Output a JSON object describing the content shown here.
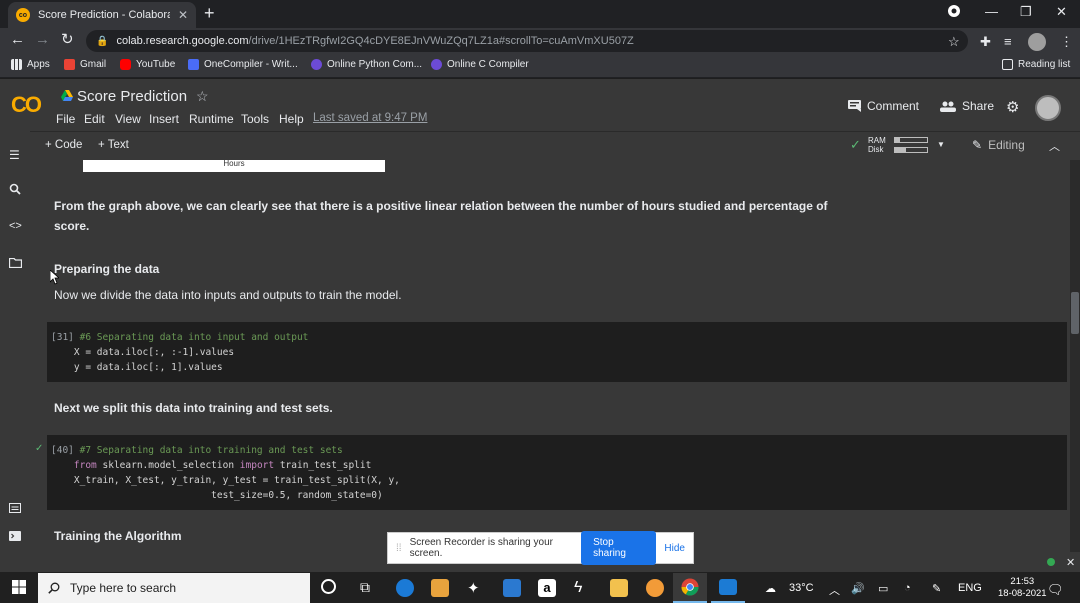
{
  "browser": {
    "tab_title": "Score Prediction - Colaboratory",
    "tab_close": "✕",
    "new_tab": "+",
    "url_host": "colab.research.google.com",
    "url_path": "/drive/1HEzTRgfwI2GQ4cDYE8EJnVWuZQq7LZ1a#scrollTo=cuAmVmXU507Z",
    "bookmarks": [
      "Apps",
      "Gmail",
      "YouTube",
      "OneCompiler - Writ...",
      "Online Python Com...",
      "Online C Compiler"
    ],
    "reading_list": "Reading list"
  },
  "colab": {
    "logo": "CO",
    "title": "Score Prediction",
    "menu": [
      "File",
      "Edit",
      "View",
      "Insert",
      "Runtime",
      "Tools",
      "Help"
    ],
    "last_saved": "Last saved at 9:47 PM",
    "comment": "Comment",
    "share": "Share",
    "add_code": "+ Code",
    "add_text": "+ Text",
    "ram_label": "RAM",
    "disk_label": "Disk",
    "ram_usage": 0.15,
    "disk_usage": 0.35,
    "editing": "Editing"
  },
  "notebook": {
    "plot_xlabel": "Hours",
    "para1": "From the graph above, we can clearly see that there is a positive linear relation between the number of hours studied and percentage of",
    "para1b": "score.",
    "heading1": "Preparing the data",
    "para2": "Now we divide the data into inputs and outputs to train the model.",
    "cell1": {
      "count": "[31]",
      "comment": "#6 Separating data into input and output",
      "line2": "X = data.iloc[:, :-1].values",
      "line3": "y = data.iloc[:, 1].values"
    },
    "para3": "Next we split this data into training and test sets.",
    "cell2": {
      "check": "✓",
      "count": "[40]",
      "comment": "#7 Separating data into training and test sets",
      "from_kw": "from",
      "module": " sklearn.model_selection ",
      "import_kw": "import",
      "func": " train_test_split",
      "line3": "X_train, X_test, y_train, y_test = train_test_split(X, y,",
      "line4": "                        test_size=0.5, random_state=0)"
    },
    "heading2": "Training the Algorithm"
  },
  "banner": {
    "grip": "⁞⁞",
    "message": "Screen Recorder is sharing your screen.",
    "stop": "Stop sharing",
    "hide": "Hide"
  },
  "taskbar": {
    "search_placeholder": "Type here to search",
    "weather": "33°C",
    "language": "ENG",
    "time": "21:53",
    "date": "18-08-2021"
  }
}
